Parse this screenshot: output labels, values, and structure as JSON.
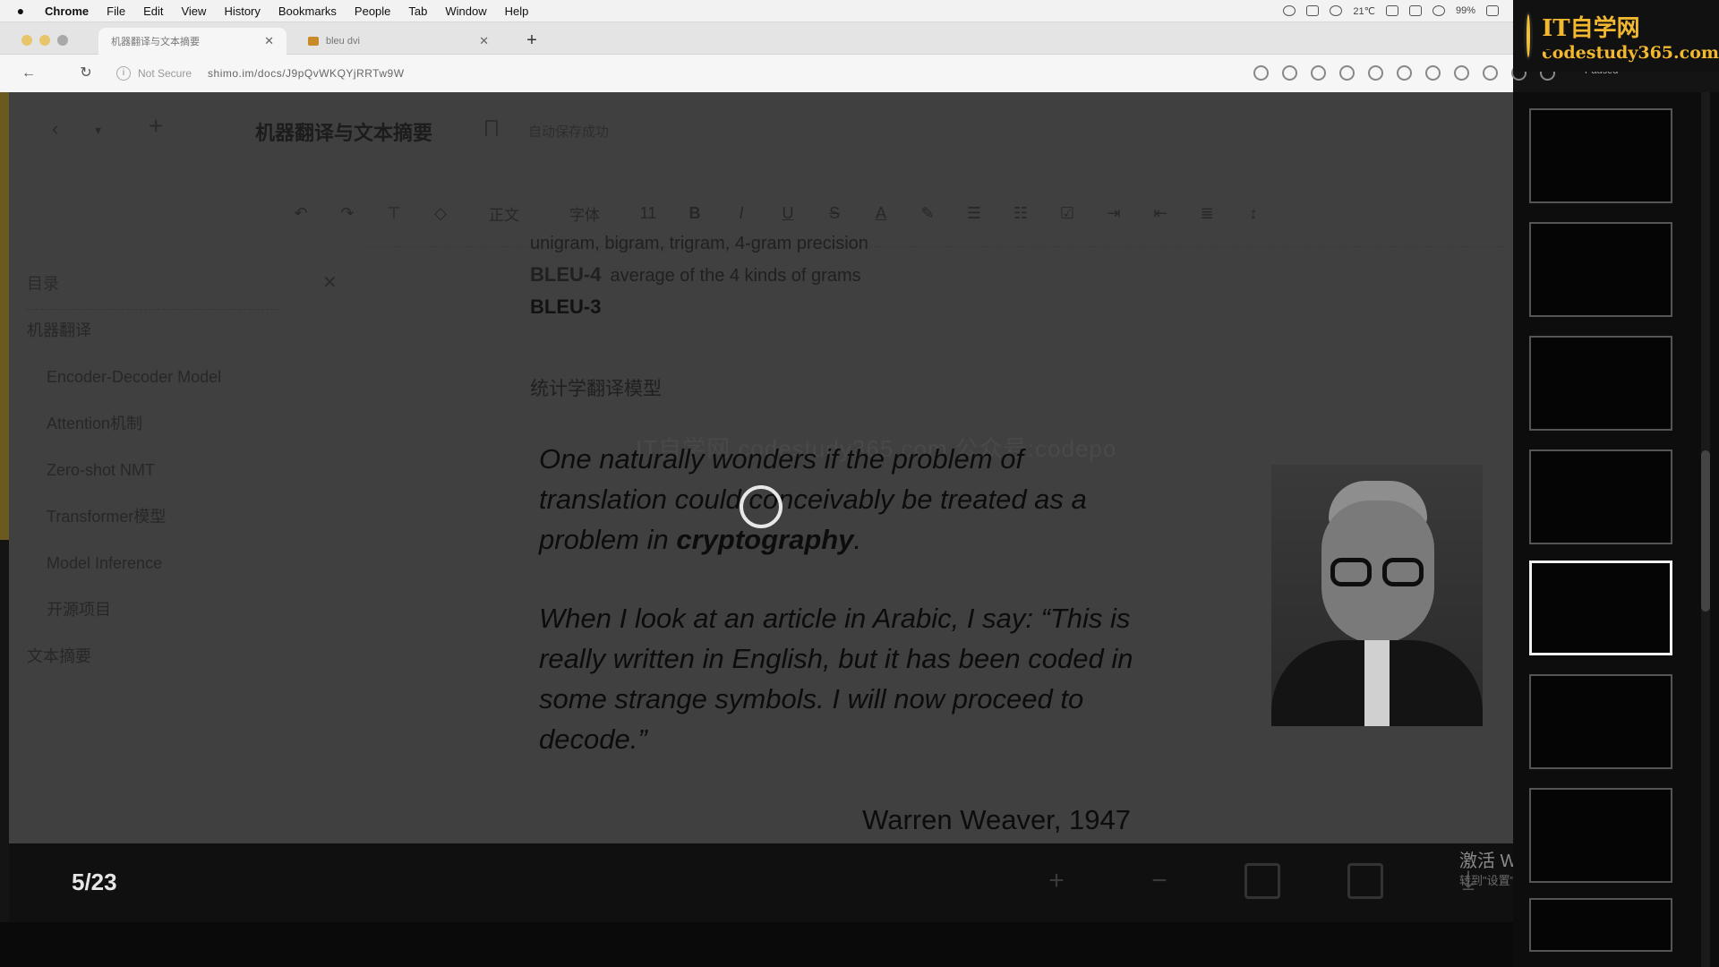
{
  "menubar": {
    "app": "Chrome",
    "items": [
      "File",
      "Edit",
      "View",
      "History",
      "Bookmarks",
      "People",
      "Tab",
      "Window",
      "Help"
    ],
    "battery": "99%",
    "temp": "21℃"
  },
  "browser": {
    "tabs": [
      {
        "title": "机器翻译与文本摘要"
      },
      {
        "title": "bleu dvi"
      }
    ],
    "security": "Not Secure",
    "url": "shimo.im/docs/J9pQvWKQYjRRTw9W",
    "profile_status": "Paused"
  },
  "logo": {
    "line1": "IT自学网",
    "line2": "codestudy365.com"
  },
  "app": {
    "doc_title": "机器翻译与文本摘要",
    "autosave": "自动保存成功",
    "toolbar": {
      "style": "正文",
      "font": "字体",
      "size": "11",
      "bold": "B",
      "italic": "I",
      "underline": "U",
      "strike": "S",
      "color": "A"
    },
    "toc": {
      "title": "目录",
      "items": [
        {
          "label": "机器翻译",
          "level": 1
        },
        {
          "label": "Encoder-Decoder Model",
          "level": 2
        },
        {
          "label": "Attention机制",
          "level": 2
        },
        {
          "label": "Zero-shot NMT",
          "level": 2
        },
        {
          "label": "Transformer模型",
          "level": 2
        },
        {
          "label": "Model Inference",
          "level": 2
        },
        {
          "label": "开源项目",
          "level": 2
        },
        {
          "label": "文本摘要",
          "level": 1
        }
      ]
    },
    "doc": {
      "line1": "unigram, bigram, trigram, 4-gram precision",
      "bleu4_label": "BLEU-4",
      "bleu4_text": "average of the 4 kinds of grams",
      "bleu3_label": "BLEU-3",
      "section": "统计学翻译模型"
    }
  },
  "slide": {
    "quote1_a": "One naturally wonders if the problem of translation could conceivably be treated as a problem in ",
    "quote1_b": "cryptography",
    "quote1_c": ".",
    "quote2": "When I look at an article in Arabic, I say: “This is really written in English, but it has been coded in some strange symbols. I will now proceed to decode.”",
    "attribution": "Warren Weaver, 1947",
    "watermark": "IT自学网 codestudy365.com 公众号:codepo"
  },
  "viewer": {
    "page": "5/23",
    "windows_activation": "激活 Windows",
    "windows_activation_sub": "转到\"设置\"以激活 Windows。"
  }
}
